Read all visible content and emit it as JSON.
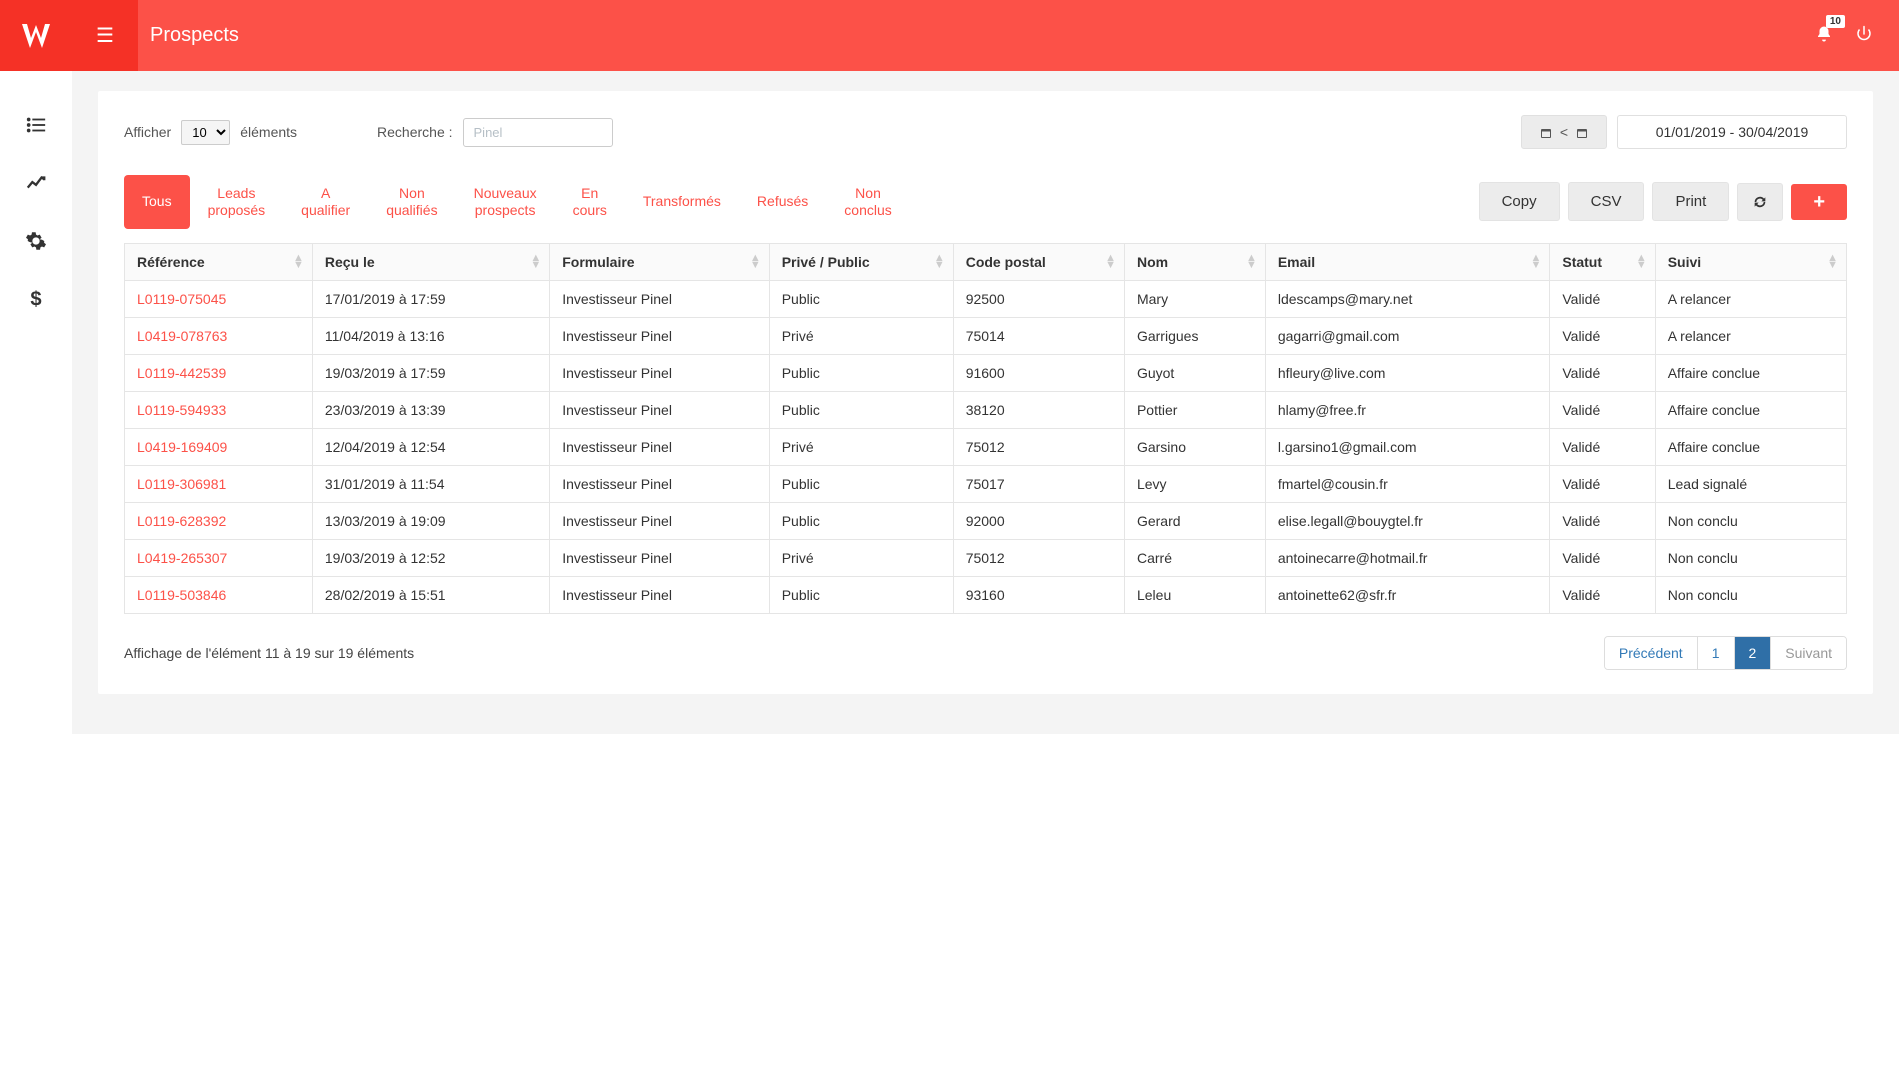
{
  "header": {
    "title": "Prospects",
    "notification_count": "10"
  },
  "sidebar": {
    "items": [
      {
        "name": "sidebar-list"
      },
      {
        "name": "sidebar-chart"
      },
      {
        "name": "sidebar-settings"
      },
      {
        "name": "sidebar-billing"
      }
    ]
  },
  "controls": {
    "show_label_prefix": "Afficher",
    "show_label_suffix": "éléments",
    "show_value": "10",
    "search_label": "Recherche :",
    "search_value": "Pinel",
    "date_range": "01/01/2019 - 30/04/2019"
  },
  "tabs": [
    {
      "label": "Tous",
      "active": true
    },
    {
      "label": "Leads\nproposés"
    },
    {
      "label": "A\nqualifier"
    },
    {
      "label": "Non\nqualifiés"
    },
    {
      "label": "Nouveaux\nprospects"
    },
    {
      "label": "En\ncours"
    },
    {
      "label": "Transformés"
    },
    {
      "label": "Refusés"
    },
    {
      "label": "Non\nconclus"
    }
  ],
  "export": {
    "copy": "Copy",
    "csv": "CSV",
    "print": "Print"
  },
  "columns": [
    "Référence",
    "Reçu le",
    "Formulaire",
    "Privé / Public",
    "Code postal",
    "Nom",
    "Email",
    "Statut",
    "Suivi"
  ],
  "rows": [
    {
      "ref": "L0119-075045",
      "recu": "17/01/2019 à 17:59",
      "form": "Investisseur Pinel",
      "priv": "Public",
      "cp": "92500",
      "nom": "Mary",
      "email": "ldescamps@mary.net",
      "statut": "Validé",
      "suivi": "A relancer"
    },
    {
      "ref": "L0419-078763",
      "recu": "11/04/2019 à 13:16",
      "form": "Investisseur Pinel",
      "priv": "Privé",
      "cp": "75014",
      "nom": "Garrigues",
      "email": "gagarri@gmail.com",
      "statut": "Validé",
      "suivi": "A relancer"
    },
    {
      "ref": "L0119-442539",
      "recu": "19/03/2019 à 17:59",
      "form": "Investisseur Pinel",
      "priv": "Public",
      "cp": "91600",
      "nom": "Guyot",
      "email": "hfleury@live.com",
      "statut": "Validé",
      "suivi": "Affaire conclue"
    },
    {
      "ref": "L0119-594933",
      "recu": "23/03/2019 à 13:39",
      "form": "Investisseur Pinel",
      "priv": "Public",
      "cp": "38120",
      "nom": "Pottier",
      "email": "hlamy@free.fr",
      "statut": "Validé",
      "suivi": "Affaire conclue"
    },
    {
      "ref": "L0419-169409",
      "recu": "12/04/2019 à 12:54",
      "form": "Investisseur Pinel",
      "priv": "Privé",
      "cp": "75012",
      "nom": "Garsino",
      "email": "l.garsino1@gmail.com",
      "statut": "Validé",
      "suivi": "Affaire conclue"
    },
    {
      "ref": "L0119-306981",
      "recu": "31/01/2019 à 11:54",
      "form": "Investisseur Pinel",
      "priv": "Public",
      "cp": "75017",
      "nom": "Levy",
      "email": "fmartel@cousin.fr",
      "statut": "Validé",
      "suivi": "Lead signalé"
    },
    {
      "ref": "L0119-628392",
      "recu": "13/03/2019 à 19:09",
      "form": "Investisseur Pinel",
      "priv": "Public",
      "cp": "92000",
      "nom": "Gerard",
      "email": "elise.legall@bouygtel.fr",
      "statut": "Validé",
      "suivi": "Non conclu"
    },
    {
      "ref": "L0419-265307",
      "recu": "19/03/2019 à 12:52",
      "form": "Investisseur Pinel",
      "priv": "Privé",
      "cp": "75012",
      "nom": "Carré",
      "email": "antoinecarre@hotmail.fr",
      "statut": "Validé",
      "suivi": "Non conclu"
    },
    {
      "ref": "L0119-503846",
      "recu": "28/02/2019 à 15:51",
      "form": "Investisseur Pinel",
      "priv": "Public",
      "cp": "93160",
      "nom": "Leleu",
      "email": "antoinette62@sfr.fr",
      "statut": "Validé",
      "suivi": "Non conclu"
    }
  ],
  "footer": {
    "info": "Affichage de l'élément 11 à 19 sur 19 éléments",
    "prev": "Précédent",
    "next": "Suivant",
    "pages": [
      "1",
      "2"
    ],
    "active_page": "2"
  }
}
